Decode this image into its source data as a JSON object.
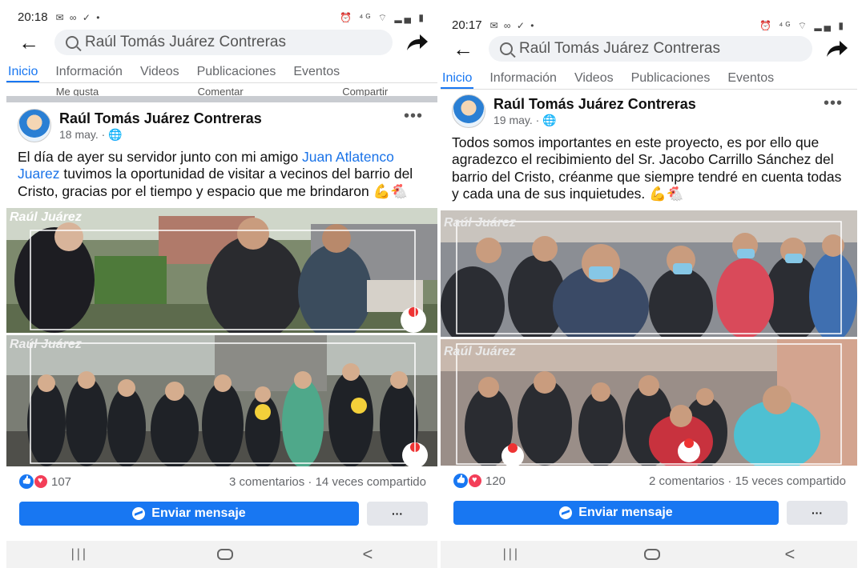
{
  "left": {
    "status_time": "20:18",
    "search_text": "Raúl Tomás Juárez Contreras",
    "tabs": [
      "Inicio",
      "Información",
      "Videos",
      "Publicaciones",
      "Eventos"
    ],
    "prev_actions": [
      "Me gusta",
      "Comentar",
      "Compartir"
    ],
    "author": "Raúl Tomás Juárez Contreras",
    "date": "18 may. · ",
    "text_before": "El día de ayer su servidor junto con mi amigo ",
    "text_link": "Juan Atlatenco Juarez",
    "text_after": " tuvimos la oportunidad de visitar a vecinos del barrio del Cristo, gracias por el tiempo y espacio que me brindaron 💪🐔",
    "photo_label": "Raúl Juárez",
    "reaction_count": "107",
    "engagement": "3 comentarios · 14 veces compartido",
    "send_label": "Enviar mensaje",
    "more_label": "···"
  },
  "right": {
    "status_time": "20:17",
    "search_text": "Raúl Tomás Juárez Contreras",
    "tabs": [
      "Inicio",
      "Información",
      "Videos",
      "Publicaciones",
      "Eventos"
    ],
    "author": "Raúl Tomás Juárez Contreras",
    "date": "19 may. · ",
    "text": "Todos somos importantes en este proyecto, es por ello que agradezco el recibimiento del Sr. Jacobo Carrillo Sánchez del barrio del Cristo, créanme que siempre tendré en cuenta todas y cada una de sus inquietudes. 💪🐔",
    "photo_label": "Raúl Juárez",
    "reaction_count": "120",
    "engagement": "2 comentarios · 15 veces compartido",
    "send_label": "Enviar mensaje",
    "more_label": "···"
  },
  "icons": {
    "back": "back-arrow-icon",
    "search": "search-icon",
    "share": "share-arrow-icon",
    "more": "more-dots-icon",
    "like": "like-icon",
    "love": "love-icon",
    "messenger": "messenger-icon",
    "globe": "globe-icon"
  },
  "colors": {
    "accent": "#1877f2",
    "love": "#f33e58",
    "secondary_text": "#65676b",
    "link": "#1a73e8"
  },
  "nav": {
    "back_glyph": "<"
  }
}
